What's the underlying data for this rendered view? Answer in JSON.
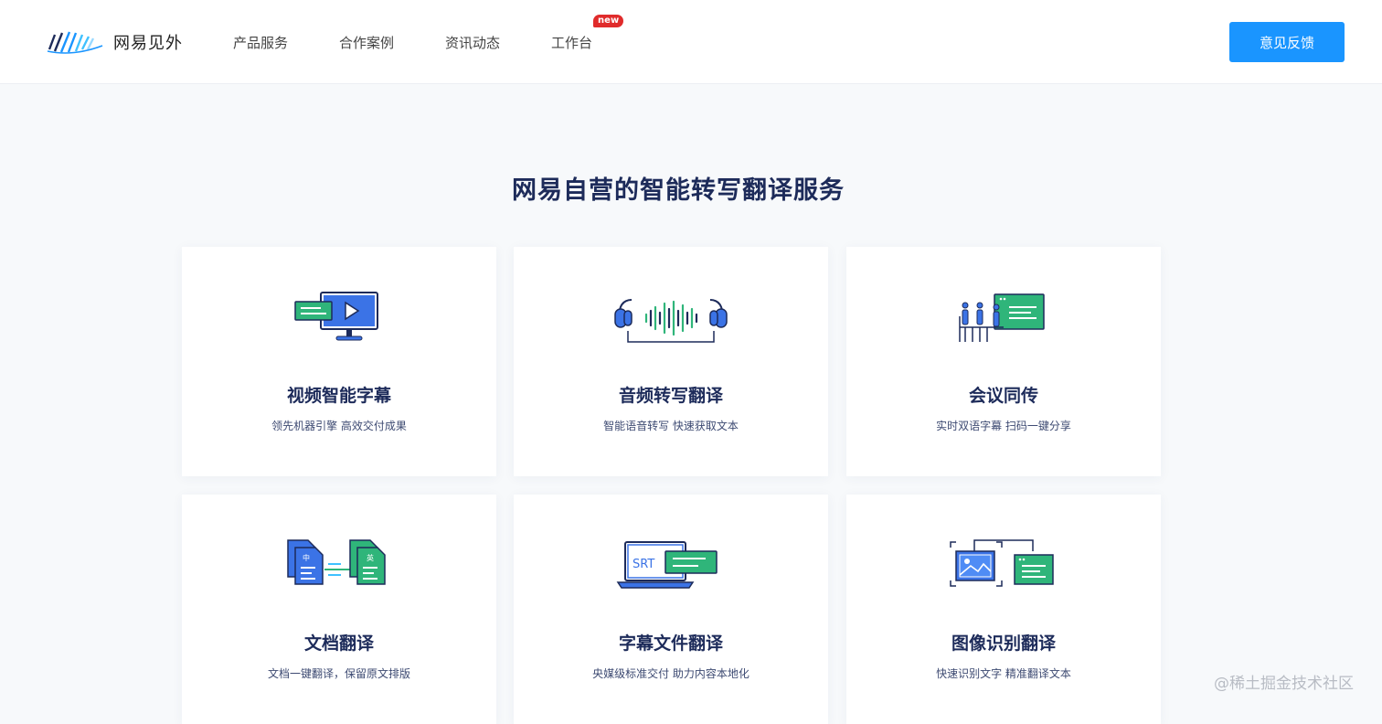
{
  "header": {
    "logo_text": "网易见外",
    "nav": [
      {
        "label": "产品服务"
      },
      {
        "label": "合作案例"
      },
      {
        "label": "资讯动态"
      },
      {
        "label": "工作台",
        "badge": "new"
      }
    ],
    "feedback_label": "意见反馈"
  },
  "main": {
    "title": "网易自营的智能转写翻译服务",
    "cards": [
      {
        "title": "视频智能字幕",
        "desc": "领先机器引擎 高效交付成果",
        "icon": "video-subtitle-icon"
      },
      {
        "title": "音频转写翻译",
        "desc": "智能语音转写 快速获取文本",
        "icon": "audio-transcribe-icon"
      },
      {
        "title": "会议同传",
        "desc": "实时双语字幕 扫码一键分享",
        "icon": "meeting-interpret-icon"
      },
      {
        "title": "文档翻译",
        "desc": "文档一键翻译，保留原文排版",
        "icon": "document-translate-icon",
        "icon_text": [
          "中",
          "英"
        ]
      },
      {
        "title": "字幕文件翻译",
        "desc": "央媒级标准交付 助力内容本地化",
        "icon": "subtitle-file-icon",
        "icon_text": "SRT"
      },
      {
        "title": "图像识别翻译",
        "desc": "快速识别文字 精准翻译文本",
        "icon": "image-recognition-icon"
      }
    ]
  },
  "watermark": "@稀土掘金技术社区",
  "colors": {
    "accent_blue": "#1a95ff",
    "icon_blue": "#3b73e6",
    "icon_green": "#2fb57a",
    "title_navy": "#1d2b5a",
    "badge_red": "#e02b2b"
  }
}
